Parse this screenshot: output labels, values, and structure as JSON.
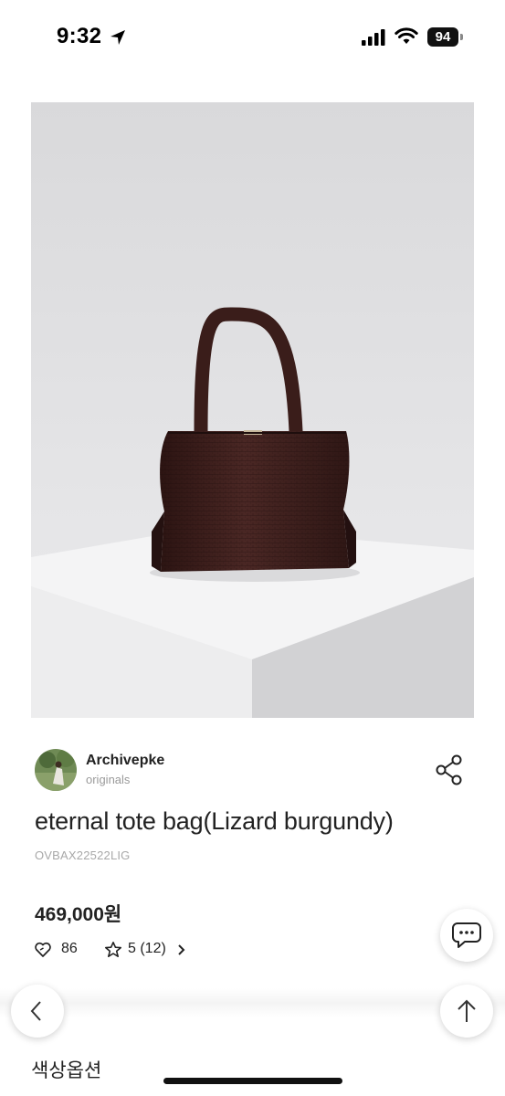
{
  "status_bar": {
    "time": "9:32",
    "battery": "94",
    "icons": [
      "location-arrow-icon",
      "signal-icon",
      "wifi-icon",
      "battery-icon"
    ]
  },
  "product_image": {
    "alt": "eternal tote bag(Lizard burgundy)",
    "colors": {
      "bag": "#3b1f1c",
      "background": "#e3e3e5",
      "pedestal": "#f2f2f2"
    }
  },
  "seller": {
    "name": "Archivepke",
    "subtitle": "originals"
  },
  "product": {
    "title": "eternal tote bag(Lizard burgundy)",
    "code": "OVBAX22522LIG",
    "price": "469,000원",
    "likes": "86",
    "rating": "5 (12)"
  },
  "option": {
    "label": "색상옵션"
  },
  "icons": [
    "share-icon",
    "heart-icon",
    "star-icon",
    "chevron-right-icon",
    "chat-icon",
    "chevron-left-icon",
    "arrow-up-icon"
  ]
}
